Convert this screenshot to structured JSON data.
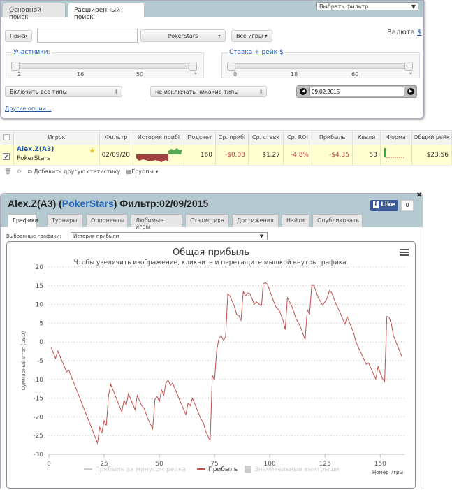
{
  "search": {
    "tabs": [
      "Основной поиск",
      "Расширенный поиск"
    ],
    "filter_select": "Выбрать фильтр",
    "search_btn": "Поиск",
    "search_value": "",
    "site": "PokerStars",
    "games": "Все игры ▾",
    "currency_label": "Валюта:",
    "currency": "$",
    "players": {
      "label": "Участники",
      "colon": ":",
      "ticks": [
        "2",
        "16",
        "50",
        "*"
      ]
    },
    "stake": {
      "label": "Ставка + рейк",
      "currency": "$",
      "ticks": [
        "0",
        "18",
        "60",
        "*"
      ]
    },
    "include": "Включить все типы",
    "exclude": "не исключать никакие типы",
    "date": "09.02.2015",
    "more": "Другие опции..."
  },
  "table": {
    "headers": [
      "Игрок",
      "Фильтр",
      "История прибі",
      "Подсчет",
      "Ср. прибі",
      "Ср. ставк",
      "Ср. ROI",
      "Прибыль",
      "Квали",
      "Форма",
      "Общий рейк"
    ],
    "row": {
      "player": "Alex.Z(A3)",
      "site": "PokerStars",
      "filter": "02/09/20",
      "count": "160",
      "avg_profit": "-$0.03",
      "avg_stake": "$1.27",
      "roi": "-4.8%",
      "profit": "-$4.35",
      "qual": "53",
      "total_rake": "$23.56",
      "checked": true
    },
    "toolbar": {
      "add": "Добавить другую статистику",
      "groups": "Группы ▾"
    }
  },
  "profile": {
    "name": "Alex.Z(A3) (",
    "site": "PokerStars",
    "filter": ") Фильтр:02/09/2015",
    "like": "Like",
    "like_count": "0",
    "tabs": [
      "Графики",
      "Турниры",
      "Оппоненты",
      "Любимые игры",
      "Статистика",
      "Достижения",
      "Найти",
      "Опубликовать"
    ],
    "selected_label": "Выбранные графики:",
    "selected": "История прибыли"
  },
  "colors": {
    "line": "#c0504d",
    "header": "#b5c9d1",
    "link": "#2255aa"
  },
  "chart_data": {
    "type": "line",
    "title": "Общая прибыль",
    "subtitle": "Чтобы увеличить изображение, кликните и перетащите мышкой внутрь графика.",
    "xlabel": "Номер игры",
    "ylabel": "Суммарный итог (USD)",
    "xlim": [
      0,
      161
    ],
    "ylim": [
      -30,
      20
    ],
    "xticks": [
      0,
      25,
      50,
      75,
      100,
      125,
      150
    ],
    "yticks": [
      20,
      15,
      10,
      5,
      0,
      -5,
      -10,
      -15,
      -20,
      -25,
      -30
    ],
    "legend": [
      "Прибыль за минусом рейка",
      "Прибыль",
      "Значительные выигрыши"
    ],
    "legend_position": "bottom",
    "series": [
      {
        "name": "Прибыль",
        "x": [
          1,
          3,
          4,
          8,
          9,
          22,
          23,
          24,
          25,
          26,
          27,
          28,
          33,
          34,
          35,
          36,
          39,
          40,
          42,
          43,
          45,
          47,
          48,
          49,
          50,
          51,
          52,
          53,
          54,
          55,
          56,
          62,
          63,
          64,
          65,
          69,
          70,
          71,
          73,
          74,
          75,
          76,
          77,
          78,
          79,
          80,
          81,
          82,
          84,
          85,
          86,
          87,
          88,
          89,
          90,
          91,
          93,
          94,
          95.8,
          96.3,
          97,
          98,
          99,
          102.6,
          104.4,
          106,
          107,
          108,
          110,
          112,
          114,
          116,
          117,
          118,
          119,
          120,
          122,
          124,
          126,
          127,
          128,
          130,
          132,
          134,
          135,
          138,
          139,
          143.7,
          144.7,
          148,
          149,
          151,
          152,
          153,
          154,
          155,
          156,
          160
        ],
        "y": [
          -1.4,
          -4.4,
          -2.4,
          -8,
          -7.5,
          -27,
          -22.8,
          -24.2,
          -21,
          -22.3,
          -14.3,
          -11.3,
          -18.7,
          -15.5,
          -16.9,
          -13.8,
          -18.1,
          -14.3,
          -17,
          -17.6,
          -20.8,
          -23.2,
          -15.3,
          -14.6,
          -15.9,
          -12.8,
          -14.2,
          -10.9,
          -10.2,
          -11.6,
          -11,
          -19.4,
          -16.3,
          -17,
          -15,
          -20.8,
          -21.7,
          -23.9,
          -26.4,
          -8.9,
          -10.2,
          -2.1,
          0.9,
          1.7,
          0.4,
          1.4,
          12.8,
          12.2,
          9.5,
          7.3,
          7,
          5.8,
          13.5,
          12.3,
          13,
          12.9,
          10.1,
          10.7,
          9.8,
          9.8,
          15.4,
          15.9,
          15.3,
          9.5,
          8.3,
          5.8,
          3.3,
          11.8,
          9.5,
          6.1,
          3.9,
          0.6,
          8.7,
          7.3,
          15.1,
          15.1,
          11.7,
          9.8,
          11.7,
          13.7,
          13.2,
          10.1,
          7.6,
          4.7,
          6.8,
          2.4,
          0,
          -6,
          -5.6,
          -9.9,
          -6.6,
          -9.8,
          -10.6,
          6.8,
          6.6,
          5,
          1.7,
          -4.2
        ]
      }
    ]
  }
}
